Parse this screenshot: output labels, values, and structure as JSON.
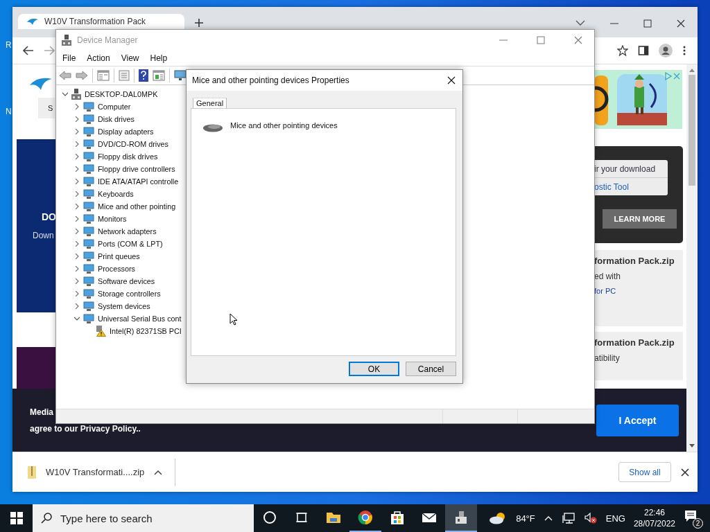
{
  "desktop": {
    "icon_labels": [
      "R",
      "N"
    ]
  },
  "browser": {
    "tabs": [
      {
        "title": "W10V Transformation Pack",
        "selected": true
      }
    ],
    "page": {
      "left": {
        "button_label": "S",
        "banner_heading": "DO",
        "banner_text": "Down"
      },
      "right": {
        "download_card": {
          "lines": [
            {
              "text": "ir your download",
              "kind": "text"
            },
            {
              "text": "ostic Tool",
              "kind": "link"
            }
          ],
          "button": "LEARN MORE"
        },
        "results": [
          {
            "title": "formation Pack.zip",
            "lines": [
              {
                "text": "ed with",
                "kind": "text"
              },
              {
                "text": "for PC",
                "kind": "link"
              }
            ]
          },
          {
            "title": "formation Pack.zip",
            "lines": [
              {
                "text": "atibility",
                "kind": "text"
              }
            ]
          }
        ]
      },
      "cookie_banner": {
        "heading": "Media",
        "text": "agree to our Privacy Policy..",
        "accept": "I Accept"
      }
    },
    "download_bar": {
      "file": "W10V Transformati....zip",
      "show_all": "Show all"
    }
  },
  "device_manager": {
    "title": "Device Manager",
    "menu": [
      "File",
      "Action",
      "View",
      "Help"
    ],
    "tree": {
      "label": "DESKTOP-DAL0MPK",
      "expanded": true,
      "children": [
        {
          "label": "Computer",
          "expanded": false
        },
        {
          "label": "Disk drives",
          "expanded": false
        },
        {
          "label": "Display adapters",
          "expanded": false
        },
        {
          "label": "DVD/CD-ROM drives",
          "expanded": false
        },
        {
          "label": "Floppy disk drives",
          "expanded": false
        },
        {
          "label": "Floppy drive controllers",
          "expanded": false
        },
        {
          "label": "IDE ATA/ATAPI controlle",
          "expanded": false
        },
        {
          "label": "Keyboards",
          "expanded": false
        },
        {
          "label": "Mice and other pointing",
          "expanded": false
        },
        {
          "label": "Monitors",
          "expanded": false
        },
        {
          "label": "Network adapters",
          "expanded": false
        },
        {
          "label": "Ports (COM & LPT)",
          "expanded": false
        },
        {
          "label": "Print queues",
          "expanded": false
        },
        {
          "label": "Processors",
          "expanded": false
        },
        {
          "label": "Software devices",
          "expanded": false
        },
        {
          "label": "Storage controllers",
          "expanded": false
        },
        {
          "label": "System devices",
          "expanded": false
        },
        {
          "label": "Universal Serial Bus cont",
          "expanded": true,
          "children": [
            {
              "label": "Intel(R) 82371SB PCI",
              "warning": true
            }
          ]
        }
      ]
    }
  },
  "properties_dialog": {
    "title": "Mice and other pointing devices Properties",
    "tabs": [
      {
        "label": "General",
        "selected": true
      }
    ],
    "device_name": "Mice and other pointing devices",
    "buttons": [
      {
        "label": "OK",
        "default": true
      },
      {
        "label": "Cancel",
        "default": false
      }
    ]
  },
  "taskbar": {
    "search_placeholder": "Type here to search",
    "apps": [
      {
        "running": false,
        "active": false
      },
      {
        "running": false,
        "active": false
      },
      {
        "running": false,
        "active": false
      },
      {
        "running": true,
        "active": false
      },
      {
        "running": false,
        "active": false
      },
      {
        "running": false,
        "active": false
      },
      {
        "running": true,
        "active": true
      }
    ],
    "weather": "84°F",
    "language": "ENG",
    "time": "22:46",
    "date": "28/07/2022",
    "notification_count": "2"
  }
}
